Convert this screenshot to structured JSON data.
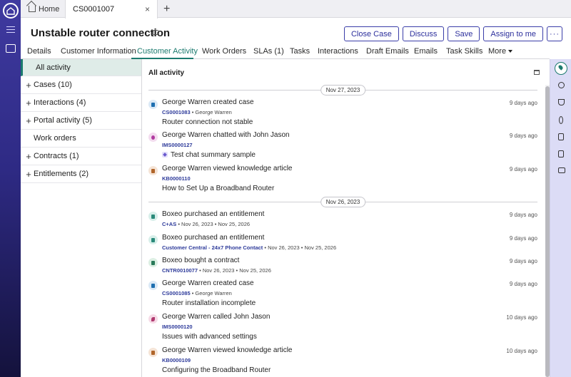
{
  "tabs": {
    "home_label": "Home",
    "case_label": "CS0001007",
    "close_glyph": "×",
    "add_glyph": "+"
  },
  "header": {
    "title": "Unstable router connection",
    "buttons": {
      "close_case": "Close Case",
      "discuss": "Discuss",
      "save": "Save",
      "assign": "Assign to me",
      "more": "···"
    }
  },
  "nav": {
    "details": "Details",
    "customer_information": "Customer Information",
    "customer_activity": "Customer Activity",
    "work_orders": "Work Orders",
    "slas": "SLAs (1)",
    "tasks": "Tasks",
    "interactions": "Interactions",
    "draft_emails": "Draft Emails",
    "emails": "Emails",
    "task_skills": "Task Skills",
    "more": "More"
  },
  "left_panel": {
    "all_activity": "All activity",
    "cases": "Cases (10)",
    "interactions": "Interactions (4)",
    "portal_activity": "Portal activity (5)",
    "work_orders": "Work orders",
    "contracts": "Contracts (1)",
    "entitlements": "Entitlements (2)",
    "plus": "+"
  },
  "feed": {
    "title": "All activity",
    "dates": [
      "Nov 27, 2023",
      "Nov 26, 2023"
    ],
    "entries": [
      {
        "headline": "George Warren created case",
        "ref": "CS0001083",
        "meta": "• George Warren",
        "desc": "Router connection not stable",
        "ago": "9 days ago",
        "color": "#1e6fb0"
      },
      {
        "headline": "George Warren chatted with John Jason",
        "ref": "IMS0000127",
        "meta": "",
        "desc": "Test chat summary sample",
        "ago": "9 days ago",
        "color": "#b03aa0"
      },
      {
        "headline": "George Warren viewed knowledge article",
        "ref": "KB0000110",
        "meta": "",
        "desc": "How to Set Up a Broadband Router",
        "ago": "9 days ago",
        "color": "#b0652a"
      },
      {
        "headline": "Boxeo purchased an entitlement",
        "ref": "C+AS",
        "meta": "• Nov 26, 2023 • Nov 25, 2026",
        "desc": "",
        "ago": "9 days ago",
        "color": "#2a8a7a"
      },
      {
        "headline": "Boxeo purchased an entitlement",
        "ref": "Customer Central - 24x7 Phone Contact",
        "meta": "• Nov 26, 2023 • Nov 25, 2026",
        "desc": "",
        "ago": "9 days ago",
        "color": "#2a8a7a"
      },
      {
        "headline": "Boxeo bought a contract",
        "ref": "CNTR0010077",
        "meta": "• Nov 26, 2023 • Nov 25, 2026",
        "desc": "",
        "ago": "9 days ago",
        "color": "#2a7a5a"
      },
      {
        "headline": "George Warren created case",
        "ref": "CS0001085",
        "meta": "• George Warren",
        "desc": "Router installation incomplete",
        "ago": "9 days ago",
        "color": "#1e6fb0"
      },
      {
        "headline": "George Warren called John Jason",
        "ref": "IMS0000120",
        "meta": "",
        "desc": "Issues with advanced settings",
        "ago": "10 days ago",
        "color": "#b03a70"
      },
      {
        "headline": "George Warren viewed knowledge article",
        "ref": "KB0000109",
        "meta": "",
        "desc": "Configuring the Broadband Router",
        "ago": "10 days ago",
        "color": "#b0652a"
      }
    ]
  },
  "icons": {
    "rail": [
      "home-icon",
      "menu-icon",
      "inbox-icon"
    ],
    "right_rail": [
      "lightbulb-icon",
      "chart-icon",
      "graduation-icon",
      "paperclip-icon",
      "document-icon",
      "news-icon",
      "image-icon"
    ]
  },
  "colors": {
    "accent_teal": "#1b7a6e",
    "brand_indigo": "#2c2f9c",
    "rail_dark": "#2e2a84"
  }
}
